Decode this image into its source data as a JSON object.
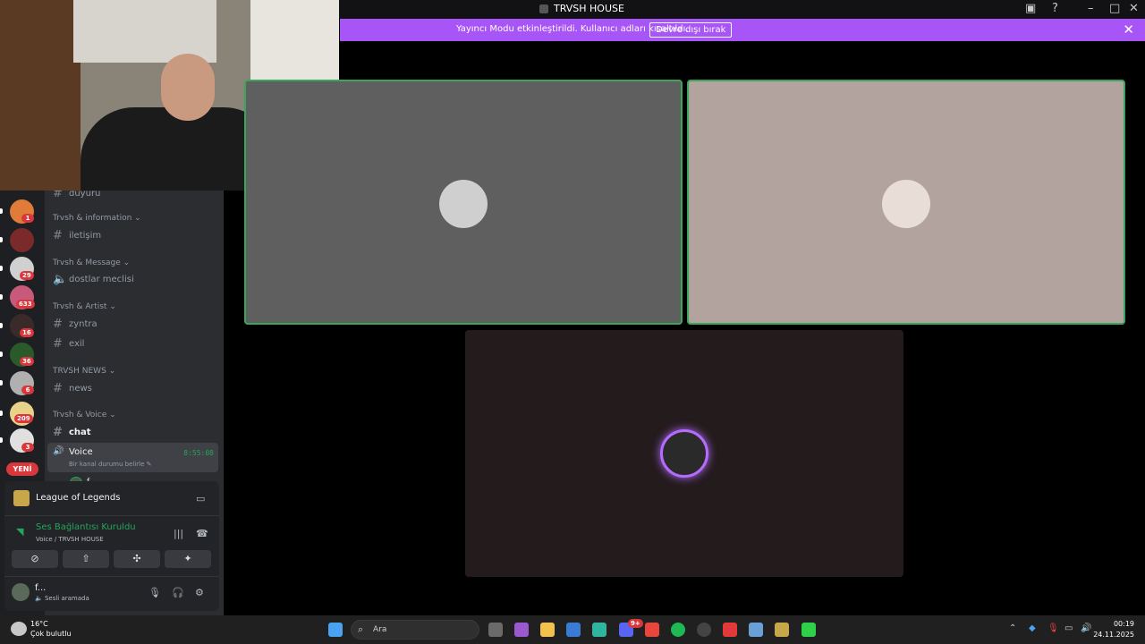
{
  "titlebar": {
    "title": "TRVSH HOUSE"
  },
  "banner": {
    "message": "Yayıncı Modu etkinleştirildi. Kullanıcı adları kısaltıldı.",
    "button": "Devre dışı bırak"
  },
  "servers": {
    "badges": [
      "1",
      "29",
      "633",
      "16",
      "36",
      "6",
      "209",
      "3"
    ],
    "new_label": "YENİ"
  },
  "channels": {
    "partial_top": "duyuru",
    "categories": [
      "Trvsh & information",
      "Trvsh & Message",
      "Trvsh & Artist",
      "TRVSH NEWS",
      "Trvsh & Voice"
    ],
    "items": [
      "iletişim",
      "dostlar meclisi",
      "zyntra",
      "exil",
      "news",
      "chat"
    ],
    "voice": {
      "name": "Voice",
      "time": "8:55:08",
      "status": "Bir kanal durumu belirle"
    },
    "voice_member": "f..."
  },
  "panel": {
    "game": "League of Legends",
    "connection": "Ses Bağlantısı Kuruldu",
    "connection_sub": "Voice / TRVSH HOUSE",
    "username": "f...",
    "user_status": "Sesli aramada"
  },
  "taskbar": {
    "weather_temp": "16°C",
    "weather_desc": "Çok bulutlu",
    "search_placeholder": "Ara",
    "time": "00:19",
    "date": "24.11.2025",
    "discord_badge": "9+"
  }
}
